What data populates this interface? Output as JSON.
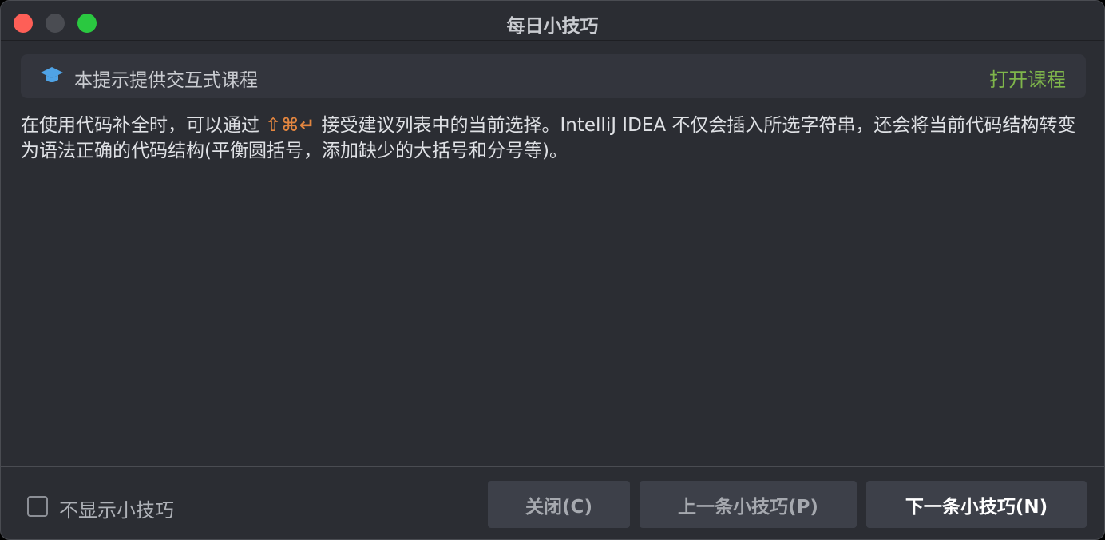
{
  "window": {
    "title": "每日小技巧"
  },
  "banner": {
    "icon": "graduation-cap-icon",
    "icon_color": "#4fa3e6",
    "text": "本提示提供交互式课程",
    "link_label": "打开课程",
    "link_color": "#7fb64b"
  },
  "tip": {
    "line_part1": "在使用代码补全时，可以通过 ",
    "shortcut": "⇧⌘↵",
    "line_part2": " 接受建议列表中的当前选择。IntelliJ IDEA 不仅会插入所选字符串，还会将当前代码结构转变为语法正确的代码结构(平衡圆括号，添加缺少的大括号和分号等)。",
    "shortcut_color": "#e2853f"
  },
  "footer": {
    "checkbox_label": "不显示小技巧",
    "checkbox_checked": false,
    "close_label": "关闭(C)",
    "prev_label": "上一条小技巧(P)",
    "next_label": "下一条小技巧(N)"
  }
}
